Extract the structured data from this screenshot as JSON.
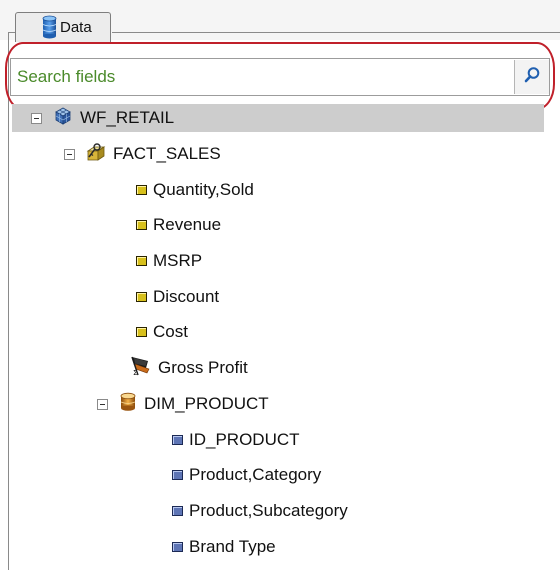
{
  "panel": {
    "tab_label": "Data",
    "tab_icon": "database-icon"
  },
  "search": {
    "placeholder": "Search fields",
    "value": "",
    "button_icon": "search-icon",
    "highlight_color": "#c0202a"
  },
  "tree": {
    "root": {
      "label": "WF_RETAIL",
      "icon": "cube-stack-icon",
      "expanded": true,
      "selected": true
    },
    "fact": {
      "label": "FACT_SALES",
      "icon": "key-folder-icon",
      "expanded": true
    },
    "measures": [
      {
        "label": "Quantity,Sold"
      },
      {
        "label": "Revenue"
      },
      {
        "label": "MSRP"
      },
      {
        "label": "Discount"
      },
      {
        "label": "Cost"
      }
    ],
    "computed": {
      "label": "Gross Profit",
      "icon": "calculator-icon"
    },
    "dimension": {
      "label": "DIM_PRODUCT",
      "icon": "cylinder-icon",
      "expanded": true
    },
    "dimension_fields": [
      {
        "label": "ID_PRODUCT"
      },
      {
        "label": "Product,Category"
      },
      {
        "label": "Product,Subcategory"
      },
      {
        "label": "Brand Type"
      }
    ]
  },
  "colors": {
    "measure": "#d7c01c",
    "dimension_field": "#5e75b5",
    "selected_row": "#cdcdcd",
    "placeholder": "#4a8a2a"
  }
}
